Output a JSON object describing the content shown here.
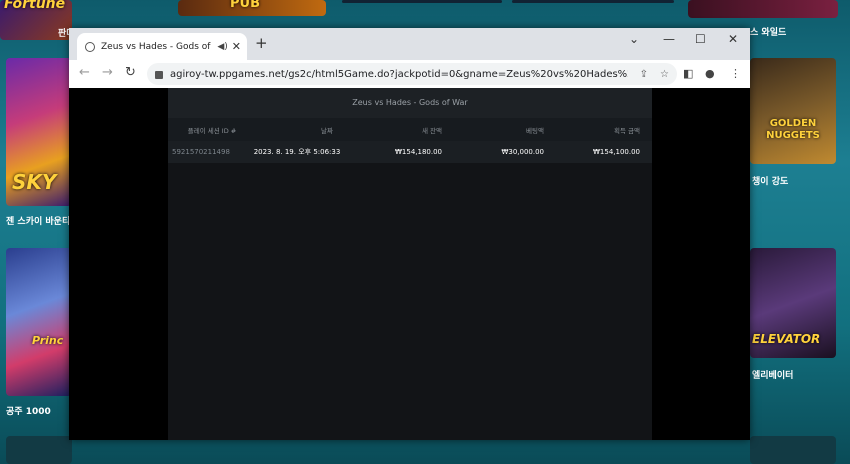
{
  "background": {
    "tile_top_left_logo": "Fortune",
    "tile_top_left_label": "판더",
    "tile_top_mid_logo": "PUB",
    "tile_top_right_label": "스 와일드",
    "tile_sky_logo": "SKY",
    "tile_sky_label": "젠 스카이 바운티",
    "tile_prince_logo": "Princ",
    "tile_prince_label": "공주 1000",
    "tile_gold_logo": "GOLDEN NUGGETS",
    "tile_gold_label": "챙이 강도",
    "tile_elev_logo": "ELEVATOR",
    "tile_elev_label": "엘리베이터"
  },
  "browser": {
    "tab_title": "Zeus vs Hades - Gods of W",
    "tab_audio_icon": "speaker-icon",
    "new_tab_label": "+",
    "url": "agiroy-tw.ppgames.net/gs2c/html5Game.do?jackpotid=0&gname=Zeus%20vs%20Hades%20-%20..."
  },
  "page": {
    "title": "Zeus vs Hades - Gods of War",
    "columns": [
      "플레이 세션 ID #",
      "날짜",
      "새 잔액",
      "베팅액",
      "획득 금액"
    ],
    "rows": [
      [
        "5921570211498",
        "2023. 8. 19. 오후 5:06:33",
        "₩154,180.00",
        "₩30,000.00",
        "₩154,100.00"
      ]
    ]
  }
}
